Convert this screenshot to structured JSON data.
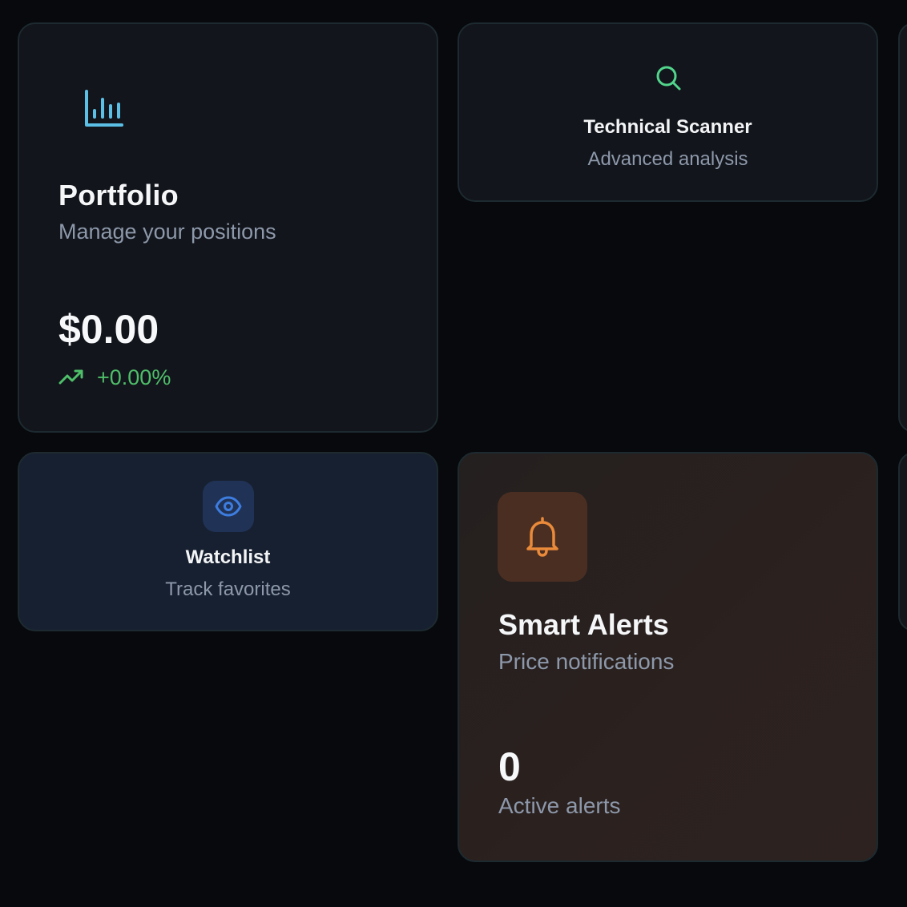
{
  "cards": {
    "portfolio": {
      "icon": "bar-chart-icon",
      "title": "Portfolio",
      "subtitle": "Manage your positions",
      "value": "$0.00",
      "change_icon": "trending-up-icon",
      "change": "+0.00%"
    },
    "scanner": {
      "icon": "search-icon",
      "title": "Technical Scanner",
      "subtitle": "Advanced analysis"
    },
    "watchlist": {
      "icon": "eye-icon",
      "title": "Watchlist",
      "subtitle": "Track favorites"
    },
    "alerts": {
      "icon": "bell-icon",
      "title": "Smart Alerts",
      "subtitle": "Price notifications",
      "count": "0",
      "count_label": "Active alerts"
    }
  },
  "colors": {
    "background": "#07090c",
    "card": "#12151b",
    "portfolio_icon": "#5bbfe6",
    "scanner_icon": "#52d48c",
    "watchlist_icon": "#3d7de0",
    "alerts_icon": "#ea8a3a",
    "positive": "#4fbf6a",
    "muted_text": "#8d98aa"
  }
}
